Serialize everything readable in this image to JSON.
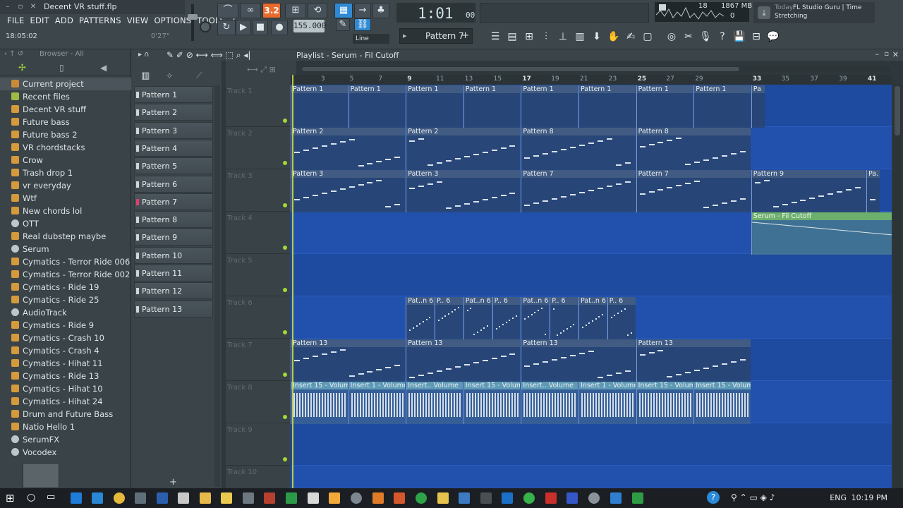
{
  "window": {
    "filename": "Decent VR stuff.flp"
  },
  "menu": {
    "items": [
      "FILE",
      "EDIT",
      "ADD",
      "PATTERNS",
      "VIEW",
      "OPTIONS",
      "TOOLS",
      "?"
    ]
  },
  "hint": {
    "time": "18:05:02",
    "right": "0'27\""
  },
  "transport": {
    "pat_label": "3.2",
    "tempo": "155.000",
    "time_main": "1:01",
    "time_sub": "00",
    "snap": "Line"
  },
  "perf": {
    "cpu": "18",
    "mem": "1867 MB",
    "mem_sub": "0"
  },
  "news": {
    "date": "Today",
    "title": "FL Studio Guru | Time",
    "subtitle": "Stretching"
  },
  "pattern_selector": {
    "label": "Pattern 7"
  },
  "browser": {
    "header": "Browser - All",
    "items": [
      {
        "label": "Current project",
        "type": "folder-brown",
        "selected": true
      },
      {
        "label": "Recent files",
        "type": "folder-green",
        "selected": false
      },
      {
        "label": "Decent VR stuff",
        "type": "file"
      },
      {
        "label": "Future bass",
        "type": "file"
      },
      {
        "label": "Future bass 2",
        "type": "file"
      },
      {
        "label": "VR chordstacks",
        "type": "file"
      },
      {
        "label": "Crow",
        "type": "file"
      },
      {
        "label": "Trash drop 1",
        "type": "file"
      },
      {
        "label": "vr everyday",
        "type": "file"
      },
      {
        "label": "Wtf",
        "type": "file"
      },
      {
        "label": "New chords lol",
        "type": "file"
      },
      {
        "label": "OTT",
        "type": "plugin"
      },
      {
        "label": "Real dubstep maybe",
        "type": "file"
      },
      {
        "label": "Serum",
        "type": "plugin"
      },
      {
        "label": "Cymatics - Terror Ride 006",
        "type": "file"
      },
      {
        "label": "Cymatics - Terror Ride 002",
        "type": "file"
      },
      {
        "label": "Cymatics - Ride 19",
        "type": "file"
      },
      {
        "label": "Cymatics - Ride 25",
        "type": "file"
      },
      {
        "label": "AudioTrack",
        "type": "plugin"
      },
      {
        "label": "Cymatics - Ride 9",
        "type": "file"
      },
      {
        "label": "Cymatics - Crash 10",
        "type": "file"
      },
      {
        "label": "Cymatics - Crash 4",
        "type": "file"
      },
      {
        "label": "Cymatics - Hihat 11",
        "type": "file"
      },
      {
        "label": "Cymatics - Ride 13",
        "type": "file"
      },
      {
        "label": "Cymatics - Hihat 10",
        "type": "file"
      },
      {
        "label": "Cymatics - Hihat 24",
        "type": "file"
      },
      {
        "label": "Drum and Future Bass",
        "type": "file"
      },
      {
        "label": "Natio Hello 1",
        "type": "file"
      },
      {
        "label": "SerumFX",
        "type": "plugin"
      },
      {
        "label": "Vocodex",
        "type": "plugin"
      }
    ]
  },
  "playlist": {
    "title": "Playlist - Serum - Fil Cutoff",
    "patterns": [
      "Pattern 1",
      "Pattern 2",
      "Pattern 3",
      "Pattern 4",
      "Pattern 5",
      "Pattern 6",
      "Pattern 7",
      "Pattern 8",
      "Pattern 9",
      "Pattern 10",
      "Pattern 11",
      "Pattern 12",
      "Pattern 13"
    ],
    "selected_pattern_index": 6,
    "tracks": [
      "Track 1",
      "Track 2",
      "Track 3",
      "Track 4",
      "Track 5",
      "Track 6",
      "Track 7",
      "Track 8",
      "Track 9",
      "Track 10"
    ],
    "ruler": [
      "3",
      "5",
      "7",
      "9",
      "11",
      "13",
      "15",
      "17",
      "19",
      "21",
      "23",
      "25",
      "27",
      "29",
      "33",
      "35",
      "37",
      "39",
      "41"
    ],
    "clips": [
      {
        "track": 0,
        "bar": 1,
        "len": 4,
        "label": "Pattern 1"
      },
      {
        "track": 0,
        "bar": 5,
        "len": 4,
        "label": "Pattern 1"
      },
      {
        "track": 0,
        "bar": 9,
        "len": 4,
        "label": "Pattern 1"
      },
      {
        "track": 0,
        "bar": 13,
        "len": 4,
        "label": "Pattern 1"
      },
      {
        "track": 0,
        "bar": 17,
        "len": 4,
        "label": "Pattern 1"
      },
      {
        "track": 0,
        "bar": 21,
        "len": 4,
        "label": "Pattern 1"
      },
      {
        "track": 0,
        "bar": 25,
        "len": 4,
        "label": "Pattern 1"
      },
      {
        "track": 0,
        "bar": 29,
        "len": 4,
        "label": "Pattern 1"
      },
      {
        "track": 0,
        "bar": 33,
        "len": 1,
        "label": "Pa"
      },
      {
        "track": 1,
        "bar": 1,
        "len": 8,
        "label": "Pattern 2"
      },
      {
        "track": 1,
        "bar": 9,
        "len": 8,
        "label": "Pattern 2"
      },
      {
        "track": 1,
        "bar": 17,
        "len": 8,
        "label": "Pattern 8"
      },
      {
        "track": 1,
        "bar": 25,
        "len": 8,
        "label": "Pattern 8"
      },
      {
        "track": 2,
        "bar": 1,
        "len": 8,
        "label": "Pattern 3"
      },
      {
        "track": 2,
        "bar": 9,
        "len": 8,
        "label": "Pattern 3"
      },
      {
        "track": 2,
        "bar": 17,
        "len": 8,
        "label": "Pattern 7"
      },
      {
        "track": 2,
        "bar": 25,
        "len": 8,
        "label": "Pattern 7"
      },
      {
        "track": 2,
        "bar": 33,
        "len": 8,
        "label": "Pattern 9"
      },
      {
        "track": 2,
        "bar": 41,
        "len": 1,
        "label": "Pa. 9"
      },
      {
        "track": 5,
        "bar": 9,
        "len": 2,
        "label": "Pat..n 6"
      },
      {
        "track": 5,
        "bar": 11,
        "len": 2,
        "label": "P.. 6"
      },
      {
        "track": 5,
        "bar": 13,
        "len": 2,
        "label": "Pat..n 6"
      },
      {
        "track": 5,
        "bar": 15,
        "len": 2,
        "label": "P.. 6"
      },
      {
        "track": 5,
        "bar": 17,
        "len": 2,
        "label": "Pat..n 6"
      },
      {
        "track": 5,
        "bar": 19,
        "len": 2,
        "label": "P.. 6"
      },
      {
        "track": 5,
        "bar": 21,
        "len": 2,
        "label": "Pat..n 6"
      },
      {
        "track": 5,
        "bar": 23,
        "len": 2,
        "label": "P.. 6"
      },
      {
        "track": 6,
        "bar": 1,
        "len": 8,
        "label": "Pattern 13"
      },
      {
        "track": 6,
        "bar": 9,
        "len": 8,
        "label": "Pattern 13"
      },
      {
        "track": 6,
        "bar": 17,
        "len": 8,
        "label": "Pattern 13"
      },
      {
        "track": 6,
        "bar": 25,
        "len": 8,
        "label": "Pattern 13"
      }
    ],
    "automation_label": "Serum - Fil Cutoff",
    "volume_clips": [
      {
        "bar": 1,
        "len": 4,
        "label": "Insert 15 - Volume"
      },
      {
        "bar": 5,
        "len": 4,
        "label": "Insert 1 - Volume"
      },
      {
        "bar": 9,
        "len": 4,
        "label": "Insert.. Volume"
      },
      {
        "bar": 13,
        "len": 4,
        "label": "Insert 15 - Volume"
      },
      {
        "bar": 17,
        "len": 4,
        "label": "Insert.. Volume"
      },
      {
        "bar": 21,
        "len": 4,
        "label": "Insert 1 - Volume"
      },
      {
        "bar": 25,
        "len": 4,
        "label": "Insert 15 - Volume"
      },
      {
        "bar": 29,
        "len": 4,
        "label": "Insert 15 - Volume"
      }
    ]
  },
  "taskbar": {
    "time": "10:19 PM",
    "lang": "ENG"
  },
  "colors": {
    "grid": "#1e4aa0",
    "accent": "#2f8ad3",
    "record": "#e86b2e",
    "led": "#a3d838",
    "automation": "#6db06d"
  }
}
